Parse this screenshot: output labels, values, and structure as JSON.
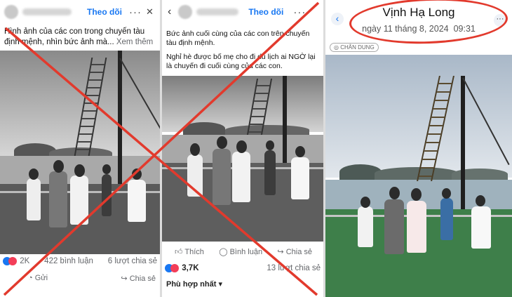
{
  "colors": {
    "accent": "#1877f2",
    "cross": "#e23a2d",
    "ellipse": "#e23a2d"
  },
  "post1": {
    "follow_label": "Theo dõi",
    "caption": "Hình ảnh của các con trong chuyến tàu định mệnh, nhìn bức ảnh mà...",
    "see_more": "Xem thêm",
    "reaction_count": "2K",
    "comments": "422 bình luận",
    "shares": "6 lượt chia sẻ",
    "action_send": "Gửi",
    "action_share": "Chia sẻ"
  },
  "post2": {
    "follow_label": "Theo dõi",
    "caption_1": "Bức ảnh cuối cùng của các con trên chuyến tàu định mệnh.",
    "caption_2": "Nghỉ hè được bố mẹ cho đi du lịch ai NGỜ lại là chuyến đi cuối cùng của các con.",
    "action_like": "Thích",
    "action_comment": "Bình luận",
    "action_share": "Chia sẻ",
    "reaction_count": "3,7K",
    "shares": "13 lượt chia sẻ",
    "sort_label": "Phù hợp nhất"
  },
  "post3": {
    "title": "Vịnh Hạ Long",
    "date": "ngày 11 tháng 8, 2024",
    "time": "09:31",
    "badge": "CHÂN DUNG"
  }
}
